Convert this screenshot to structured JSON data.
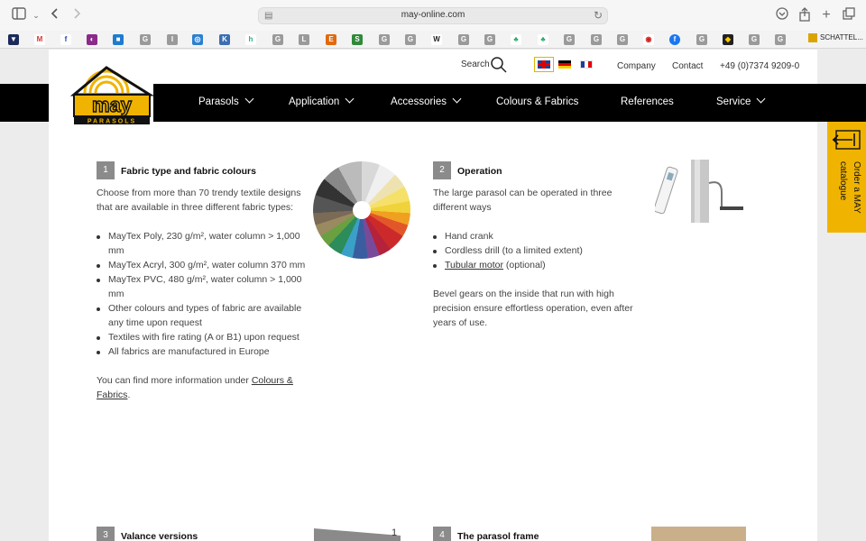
{
  "browser": {
    "url": "may-online.com",
    "favorites_last_label": "SCHATTEL..."
  },
  "topbar": {
    "search_label": "Search",
    "links": [
      "Company",
      "Contact",
      "+49 (0)7374 9209-0"
    ]
  },
  "nav": {
    "items": [
      {
        "label": "Parasols",
        "has_dropdown": true
      },
      {
        "label": "Application",
        "has_dropdown": true
      },
      {
        "label": "Accessories",
        "has_dropdown": true
      },
      {
        "label": "Colours & Fabrics",
        "has_dropdown": false
      },
      {
        "label": "References",
        "has_dropdown": false
      },
      {
        "label": "Service",
        "has_dropdown": true
      }
    ]
  },
  "logo": {
    "brand": "may",
    "tagline": "PARASOLS"
  },
  "catalogue": {
    "label": "Order a MAY catalogue"
  },
  "sections": [
    {
      "number": "1",
      "title": "Fabric type and fabric colours",
      "intro": "Choose from more than 70 trendy textile designs that are available in three different fabric types:",
      "bullets": [
        "MayTex Poly, 230 g/m², water column > 1,000 mm",
        "MayTex Acryl, 300 g/m², water column 370 mm",
        "MayTex PVC, 480 g/m², water column > 1,000 mm",
        "Other colours and types of fabric are available any time upon request",
        "Textiles with fire rating (A or B1) upon request",
        "All fabrics are manufactured in Europe"
      ],
      "outro_prefix": "You can find more information under ",
      "outro_link": "Colours & Fabrics",
      "outro_suffix": "."
    },
    {
      "number": "2",
      "title": "Operation",
      "intro": "The large parasol can be operated in three different ways",
      "bullets": [
        "Hand crank",
        "Cordless drill (to a limited extent)"
      ],
      "bullet_link": "Tubular motor",
      "bullet_link_suffix": " (optional)",
      "outro": "Bevel gears on the inside that run with high precision ensure effortless operation, even after years of use."
    },
    {
      "number": "3",
      "title": "Valance versions"
    },
    {
      "number": "4",
      "title": "The parasol frame"
    }
  ],
  "image_caption_number": "1",
  "colors": {
    "nav_bg": "#000000",
    "accent": "#f0b400",
    "number_bg": "#8b8b8b"
  }
}
